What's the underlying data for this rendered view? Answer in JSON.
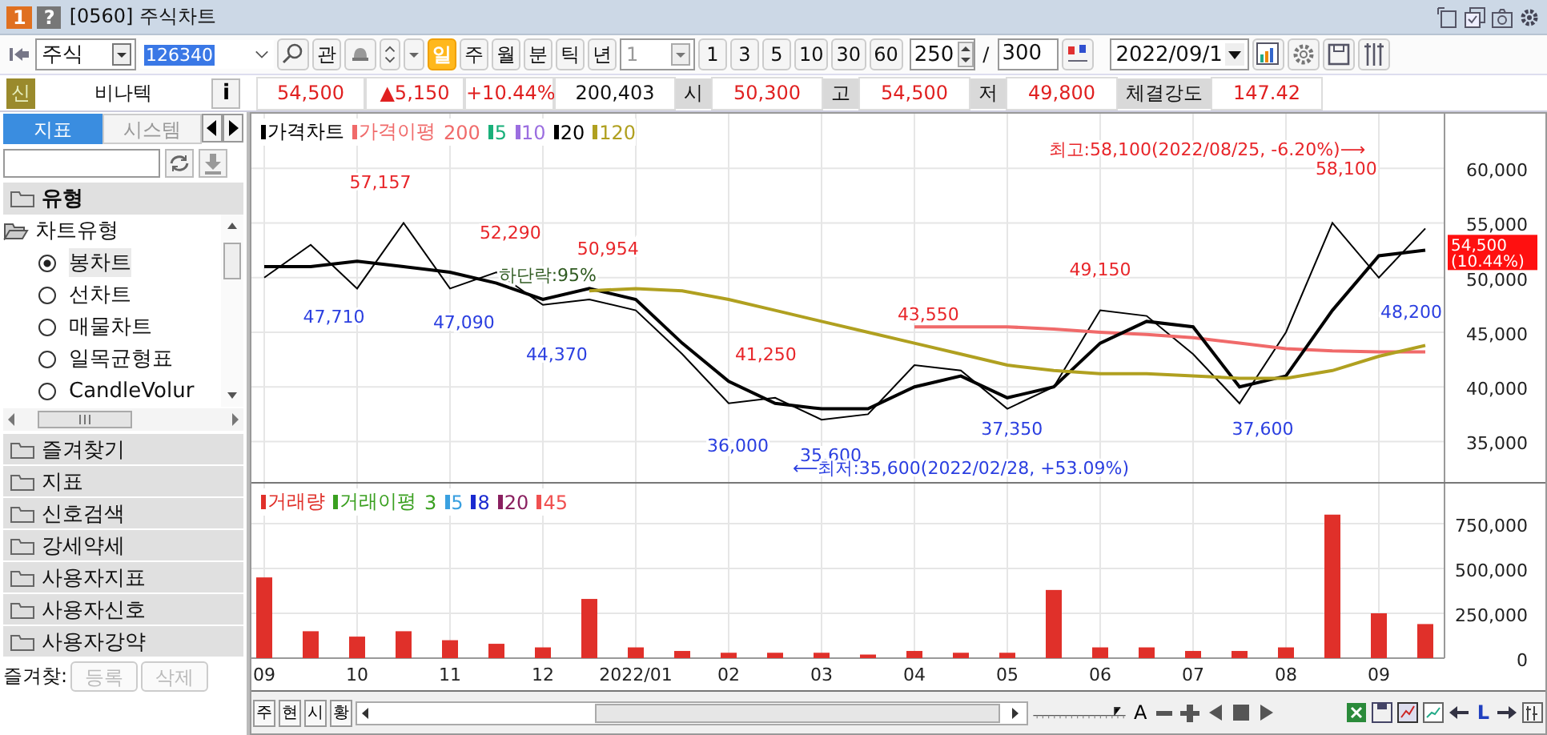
{
  "window": {
    "badge": "1",
    "help": "?",
    "title": "[0560] 주식차트"
  },
  "toolbar": {
    "market": "주식",
    "code": "126340",
    "watch_button": "관",
    "periods": [
      {
        "label": "일",
        "selected": true
      },
      {
        "label": "주",
        "selected": false
      },
      {
        "label": "월",
        "selected": false
      },
      {
        "label": "분",
        "selected": false
      },
      {
        "label": "틱",
        "selected": false
      },
      {
        "label": "년",
        "selected": false
      }
    ],
    "interval": "1",
    "counts": [
      "1",
      "3",
      "5",
      "10",
      "30",
      "60"
    ],
    "view_count": "250",
    "separator": "/",
    "total_count": "300",
    "date": "2022/09/1"
  },
  "info": {
    "badge": "신",
    "name": "비나텍",
    "info_button": "i",
    "price": "54,500",
    "change": "▲5,150",
    "change_rate": "+10.44%",
    "volume": "200,403",
    "fields": [
      {
        "label": "시",
        "value": "50,300"
      },
      {
        "label": "고",
        "value": "54,500"
      },
      {
        "label": "저",
        "value": "49,800"
      },
      {
        "label": "체결강도",
        "value": "147.42"
      }
    ]
  },
  "sidebar": {
    "tabs": [
      {
        "label": "지표",
        "selected": true
      },
      {
        "label": "시스템",
        "selected": false
      }
    ],
    "section": "유형",
    "tree": {
      "label": "차트유형",
      "expanded": true,
      "children": [
        {
          "label": "봉차트",
          "selected": true
        },
        {
          "label": "선차트",
          "selected": false
        },
        {
          "label": "매물차트",
          "selected": false
        },
        {
          "label": "일목균형표",
          "selected": false
        },
        {
          "label": "CandleVolur",
          "selected": false
        }
      ]
    },
    "folders": [
      "즐겨찾기",
      "지표",
      "신호검색",
      "강세약세",
      "사용자지표",
      "사용자신호",
      "사용자강약"
    ],
    "favorites_label": "즐겨찾:",
    "buttons": [
      {
        "label": "등록",
        "disabled": true
      },
      {
        "label": "삭제",
        "disabled": true
      }
    ]
  },
  "price_chart": {
    "legend": [
      {
        "label": "가격차트",
        "color": "#000000",
        "marker": true
      },
      {
        "label": "가격이평",
        "color": "#f06a6a",
        "marker": true
      },
      {
        "label": "200",
        "color": "#f06a6a",
        "marker": false
      },
      {
        "label": "5",
        "color": "#19b07a",
        "marker": true
      },
      {
        "label": "10",
        "color": "#9b6ee0",
        "marker": true
      },
      {
        "label": "20",
        "color": "#000000",
        "marker": true
      },
      {
        "label": "120",
        "color": "#b0a020",
        "marker": true
      }
    ],
    "current_price": {
      "value": "54,500",
      "change": "(10.44%)"
    },
    "marks": [
      {
        "text": "57,157",
        "color": "#e8262a"
      },
      {
        "text": "47,710",
        "color": "#2b3fe0"
      },
      {
        "text": "52,290",
        "color": "#e8262a"
      },
      {
        "text": "47,090",
        "color": "#2b3fe0"
      },
      {
        "text": "44,370",
        "color": "#2b3fe0"
      },
      {
        "text": "하단락:95%",
        "color": "#2f5a20"
      },
      {
        "text": "50,954",
        "color": "#e8262a"
      },
      {
        "text": "41,250",
        "color": "#e8262a"
      },
      {
        "text": "36,000",
        "color": "#2b3fe0"
      },
      {
        "text": "35,600",
        "color": "#2b3fe0"
      },
      {
        "text": "43,550",
        "color": "#e8262a"
      },
      {
        "text": "49,150",
        "color": "#e8262a"
      },
      {
        "text": "37,350",
        "color": "#2b3fe0"
      },
      {
        "text": "37,600",
        "color": "#2b3fe0"
      },
      {
        "text": "58,100",
        "color": "#e8262a"
      },
      {
        "text": "48,200",
        "color": "#2b3fe0"
      },
      {
        "text": "최고:58,100(2022/08/25, -6.20%)⟶",
        "color": "#e8262a"
      },
      {
        "text": "⟵최저:35,600(2022/02/28, +53.09%)",
        "color": "#2b3fe0"
      }
    ],
    "chart_data": {
      "type": "line",
      "grid": true,
      "categories": [
        null,
        null,
        null,
        null,
        null,
        null,
        null,
        null,
        null,
        null,
        null,
        null,
        null,
        null,
        null,
        null,
        null,
        null,
        null,
        null,
        null,
        null,
        null,
        null,
        null,
        null
      ],
      "ylim": [
        31300,
        65000
      ],
      "yticks": [
        {
          "value": 35000,
          "label": "35,000"
        },
        {
          "value": 40000,
          "label": "40,000"
        },
        {
          "value": 45000,
          "label": "45,000"
        },
        {
          "value": 50000,
          "label": "50,000"
        },
        {
          "value": 55000,
          "label": "55,000"
        },
        {
          "value": 60000,
          "label": "60,000"
        }
      ],
      "series": [
        {
          "color": "#000000",
          "values": [
            50000,
            53000,
            49000,
            55000,
            49000,
            50500,
            47500,
            48000,
            47000,
            43000,
            38500,
            39000,
            37000,
            37500,
            42000,
            41500,
            38000,
            40000,
            47000,
            46500,
            43000,
            38500,
            45000,
            55000,
            50000,
            54500
          ]
        },
        {
          "color": "#f06a6a",
          "values": [
            null,
            null,
            null,
            null,
            null,
            null,
            null,
            null,
            null,
            null,
            null,
            null,
            null,
            null,
            45500,
            45500,
            45500,
            45300,
            45000,
            44800,
            44500,
            44000,
            43500,
            43300,
            43200,
            43200
          ]
        },
        {
          "color": "#000000",
          "values": [
            51000,
            51000,
            51500,
            51000,
            50500,
            49500,
            48000,
            49000,
            48000,
            44000,
            40500,
            38500,
            38000,
            38000,
            40000,
            41000,
            39000,
            40000,
            44000,
            46000,
            45500,
            40000,
            41000,
            47000,
            52000,
            52500
          ]
        },
        {
          "color": "#b0a020",
          "values": [
            null,
            null,
            null,
            null,
            null,
            null,
            null,
            48800,
            49000,
            48800,
            48000,
            47000,
            46000,
            45000,
            44000,
            43000,
            42000,
            41500,
            41200,
            41200,
            41000,
            40800,
            40800,
            41500,
            42800,
            43800
          ]
        }
      ]
    }
  },
  "volume_chart": {
    "legend": [
      {
        "label": "거래량",
        "color": "#e0302a",
        "marker": true
      },
      {
        "label": "거래이평",
        "color": "#3aa020",
        "marker": true
      },
      {
        "label": "3",
        "color": "#3aa020",
        "marker": false
      },
      {
        "label": "5",
        "color": "#3aa0e0",
        "marker": true
      },
      {
        "label": "8",
        "color": "#1a2ad0",
        "marker": true
      },
      {
        "label": "20",
        "color": "#8a2060",
        "marker": true
      },
      {
        "label": "45",
        "color": "#f05050",
        "marker": true
      }
    ],
    "chart_data": {
      "type": "bar",
      "grid": true,
      "categories": [
        "09",
        null,
        "10",
        null,
        "11",
        null,
        "12",
        null,
        "2022/01",
        null,
        "02",
        null,
        "03",
        null,
        "04",
        null,
        "05",
        null,
        "06",
        null,
        "07",
        null,
        "08",
        null,
        "09",
        null
      ],
      "ylim": [
        0,
        973000
      ],
      "yticks": [
        {
          "value": 0,
          "label": "0"
        },
        {
          "value": 250000,
          "label": "250,000"
        },
        {
          "value": 500000,
          "label": "500,000"
        },
        {
          "value": 750000,
          "label": "750,000"
        }
      ],
      "series": [
        {
          "color": "#e0302a",
          "values": [
            450000,
            150000,
            120000,
            150000,
            100000,
            80000,
            60000,
            330000,
            60000,
            40000,
            30000,
            30000,
            30000,
            20000,
            40000,
            30000,
            30000,
            380000,
            60000,
            60000,
            40000,
            40000,
            60000,
            800000,
            250000,
            190000
          ]
        }
      ]
    }
  },
  "bottom_bar": {
    "buttons": [
      "주",
      "현",
      "시",
      "황"
    ],
    "zoom": {
      "level": 0.88
    },
    "tools": [
      {
        "kind": "text",
        "label": "A"
      },
      {
        "kind": "minus"
      },
      {
        "kind": "plus"
      },
      {
        "kind": "left"
      },
      {
        "kind": "stop"
      },
      {
        "kind": "right"
      }
    ],
    "nav": [
      {
        "kind": "left-arrow"
      },
      {
        "kind": "text",
        "label": "L"
      },
      {
        "kind": "right-arrow"
      }
    ]
  }
}
